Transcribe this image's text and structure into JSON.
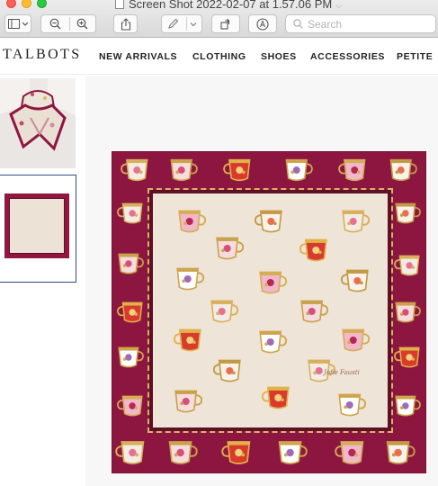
{
  "window": {
    "title": "Screen Shot 2022-02-07 at 1.57.06 PM",
    "search_placeholder": "Search"
  },
  "toolbar": {
    "buttons": [
      "sidebar-toggle",
      "zoom-out",
      "zoom-in",
      "share",
      "markup-pen",
      "rotate",
      "markup-toolbar"
    ]
  },
  "site": {
    "logo": "TALBOTS",
    "nav": [
      "NEW ARRIVALS",
      "CLOTHING",
      "SHOES",
      "ACCESSORIES",
      "PETITE"
    ]
  },
  "product": {
    "thumbnails": [
      "scarf-worn-thumbnail",
      "scarf-flat-thumbnail"
    ],
    "selected_thumbnail": 1,
    "signature": "Jofie Fausti",
    "colors": {
      "border": "#8d1640",
      "center": "#eee4d8",
      "trim": "#d7b46a"
    }
  }
}
